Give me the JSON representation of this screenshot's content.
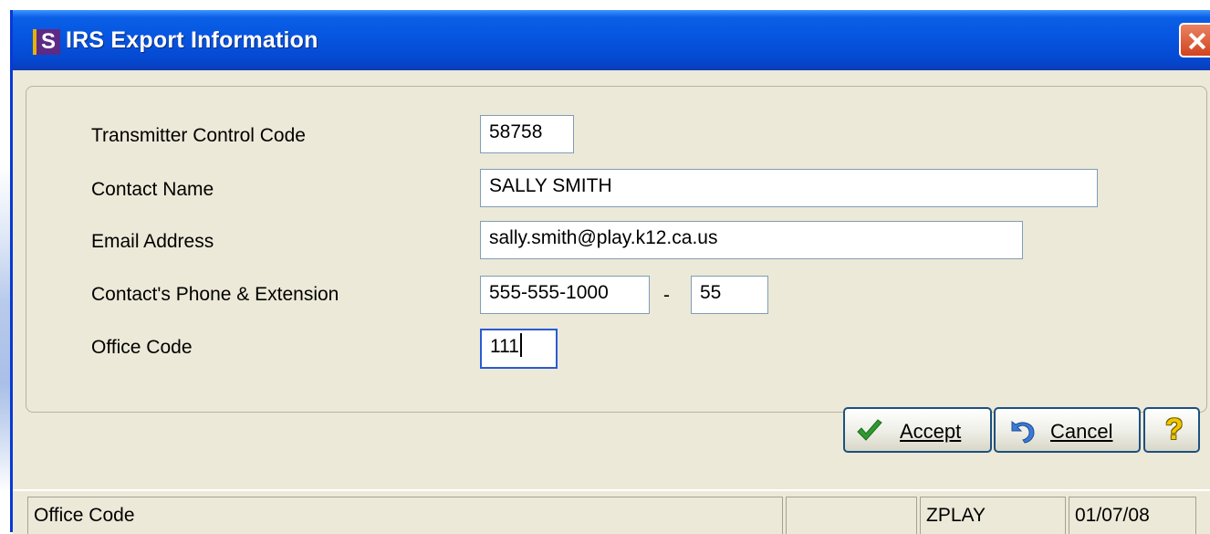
{
  "window": {
    "title": "IRS Export Information",
    "app_icon_letter": "S"
  },
  "form": {
    "transmitter_control_code": {
      "label": "Transmitter Control Code",
      "value": "58758"
    },
    "contact_name": {
      "label": "Contact Name",
      "value": "SALLY SMITH"
    },
    "email_address": {
      "label": "Email Address",
      "value": "sally.smith@play.k12.ca.us"
    },
    "contact_phone": {
      "label": "Contact's Phone & Extension",
      "value": "555-555-1000",
      "separator": "-",
      "extension": "55"
    },
    "office_code": {
      "label": "Office Code",
      "value": "111"
    }
  },
  "buttons": {
    "accept": "Accept",
    "cancel": "Cancel",
    "help": "?"
  },
  "statusbar": {
    "field_hint": "Office Code",
    "empty": "",
    "user": "ZPLAY",
    "date": "01/07/08"
  },
  "colors": {
    "titlebar": "#0655e0",
    "dialog_bg": "#ece9d8",
    "close": "#d2431e",
    "field_border": "#7f9db9"
  }
}
